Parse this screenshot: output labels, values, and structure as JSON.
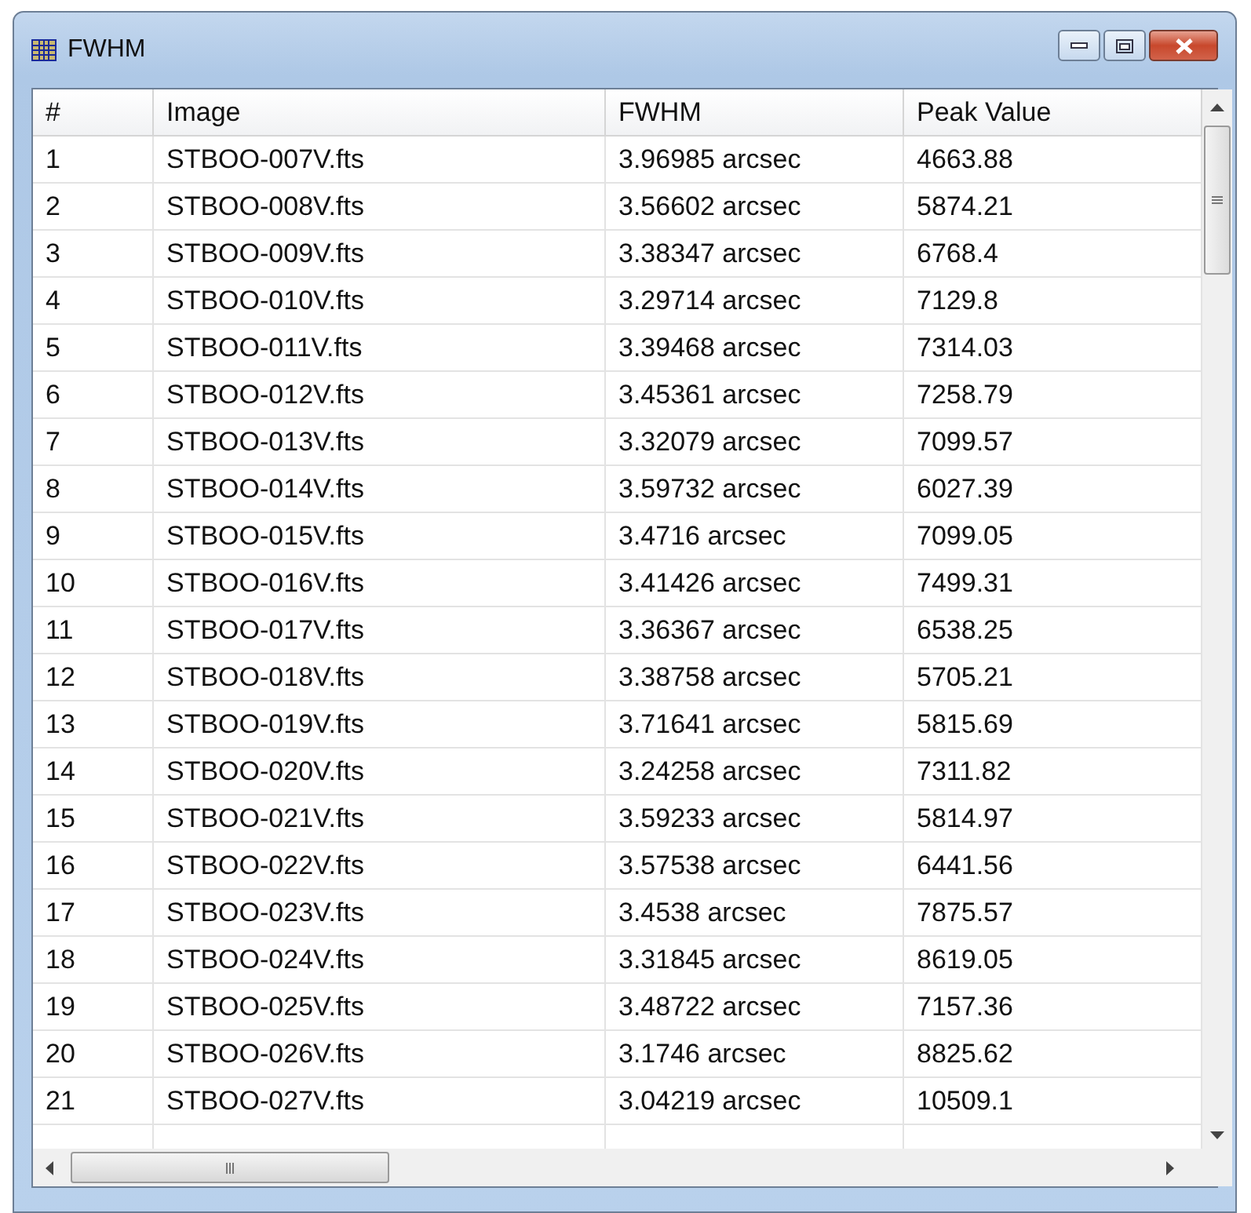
{
  "window": {
    "title": "FWHM"
  },
  "table": {
    "columns": [
      "#",
      "Image",
      "FWHM",
      "Peak Value"
    ],
    "rows": [
      [
        "1",
        "STBOO-007V.fts",
        "3.96985 arcsec",
        "4663.88"
      ],
      [
        "2",
        "STBOO-008V.fts",
        "3.56602 arcsec",
        "5874.21"
      ],
      [
        "3",
        "STBOO-009V.fts",
        "3.38347 arcsec",
        "6768.4"
      ],
      [
        "4",
        "STBOO-010V.fts",
        "3.29714 arcsec",
        "7129.8"
      ],
      [
        "5",
        "STBOO-011V.fts",
        "3.39468 arcsec",
        "7314.03"
      ],
      [
        "6",
        "STBOO-012V.fts",
        "3.45361 arcsec",
        "7258.79"
      ],
      [
        "7",
        "STBOO-013V.fts",
        "3.32079 arcsec",
        "7099.57"
      ],
      [
        "8",
        "STBOO-014V.fts",
        "3.59732 arcsec",
        "6027.39"
      ],
      [
        "9",
        "STBOO-015V.fts",
        "3.4716 arcsec",
        "7099.05"
      ],
      [
        "10",
        "STBOO-016V.fts",
        "3.41426 arcsec",
        "7499.31"
      ],
      [
        "11",
        "STBOO-017V.fts",
        "3.36367 arcsec",
        "6538.25"
      ],
      [
        "12",
        "STBOO-018V.fts",
        "3.38758 arcsec",
        "5705.21"
      ],
      [
        "13",
        "STBOO-019V.fts",
        "3.71641 arcsec",
        "5815.69"
      ],
      [
        "14",
        "STBOO-020V.fts",
        "3.24258 arcsec",
        "7311.82"
      ],
      [
        "15",
        "STBOO-021V.fts",
        "3.59233 arcsec",
        "5814.97"
      ],
      [
        "16",
        "STBOO-022V.fts",
        "3.57538 arcsec",
        "6441.56"
      ],
      [
        "17",
        "STBOO-023V.fts",
        "3.4538 arcsec",
        "7875.57"
      ],
      [
        "18",
        "STBOO-024V.fts",
        "3.31845 arcsec",
        "8619.05"
      ],
      [
        "19",
        "STBOO-025V.fts",
        "3.48722 arcsec",
        "7157.36"
      ],
      [
        "20",
        "STBOO-026V.fts",
        "3.1746 arcsec",
        "8825.62"
      ],
      [
        "21",
        "STBOO-027V.fts",
        "3.04219 arcsec",
        "10509.1"
      ]
    ]
  }
}
